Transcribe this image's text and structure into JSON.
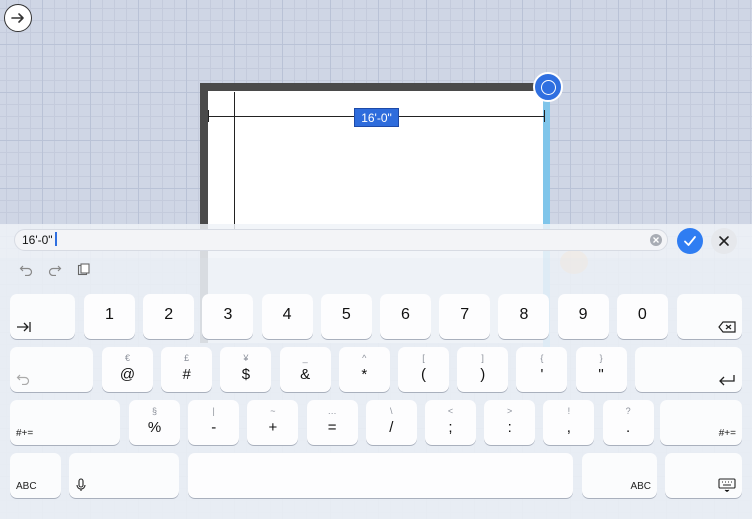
{
  "canvas": {
    "dimension_label": "16'-0\""
  },
  "measure_input": {
    "value": "16'-0\""
  },
  "keyboard": {
    "row1": [
      {
        "name": "key-1",
        "main": "1"
      },
      {
        "name": "key-2",
        "main": "2"
      },
      {
        "name": "key-3",
        "main": "3"
      },
      {
        "name": "key-4",
        "main": "4"
      },
      {
        "name": "key-5",
        "main": "5"
      },
      {
        "name": "key-6",
        "main": "6"
      },
      {
        "name": "key-7",
        "main": "7"
      },
      {
        "name": "key-8",
        "main": "8"
      },
      {
        "name": "key-9",
        "main": "9"
      },
      {
        "name": "key-0",
        "main": "0"
      }
    ],
    "row2": [
      {
        "name": "key-at",
        "alt": "€",
        "main": "@"
      },
      {
        "name": "key-hash",
        "alt": "£",
        "main": "#"
      },
      {
        "name": "key-dollar",
        "alt": "¥",
        "main": "$"
      },
      {
        "name": "key-ampersand",
        "alt": "_",
        "main": "&"
      },
      {
        "name": "key-asterisk",
        "alt": "^",
        "main": "*"
      },
      {
        "name": "key-open-paren",
        "alt": "[",
        "main": "("
      },
      {
        "name": "key-close-paren",
        "alt": "]",
        "main": ")"
      },
      {
        "name": "key-apostrophe",
        "alt": "{",
        "main": "'"
      },
      {
        "name": "key-quote",
        "alt": "}",
        "main": "\""
      }
    ],
    "row3": [
      {
        "name": "key-percent",
        "alt": "§",
        "main": "%"
      },
      {
        "name": "key-minus",
        "alt": "|",
        "main": "-"
      },
      {
        "name": "key-plus",
        "alt": "~",
        "main": "+"
      },
      {
        "name": "key-equals",
        "alt": "…",
        "main": "="
      },
      {
        "name": "key-slash",
        "alt": "\\",
        "main": "/"
      },
      {
        "name": "key-semicolon",
        "alt": "<",
        "main": ";"
      },
      {
        "name": "key-colon",
        "alt": ">",
        "main": ":"
      },
      {
        "name": "key-comma",
        "alt": "!",
        "main": ","
      },
      {
        "name": "key-period",
        "alt": "?",
        "main": "."
      }
    ],
    "labels": {
      "symbols_left": "#+=",
      "symbols_right": "#+=",
      "abc_left": "ABC",
      "abc_right": "ABC"
    }
  },
  "icons": {
    "nav": "arrow-right-icon",
    "confirm": "checkmark-icon",
    "cancel": "close-icon",
    "clear": "clear-circle-icon",
    "undo": "undo-icon",
    "redo": "redo-icon",
    "paste": "clipboard-icon",
    "tab": "tab-icon",
    "delete": "backspace-icon",
    "return": "return-icon",
    "mic": "microphone-icon",
    "hide_keyboard": "keyboard-dismiss-icon"
  },
  "colors": {
    "accent": "#2f6fe0",
    "selected_wall": "#7fc5ea",
    "wall": "#4a4a4a"
  }
}
